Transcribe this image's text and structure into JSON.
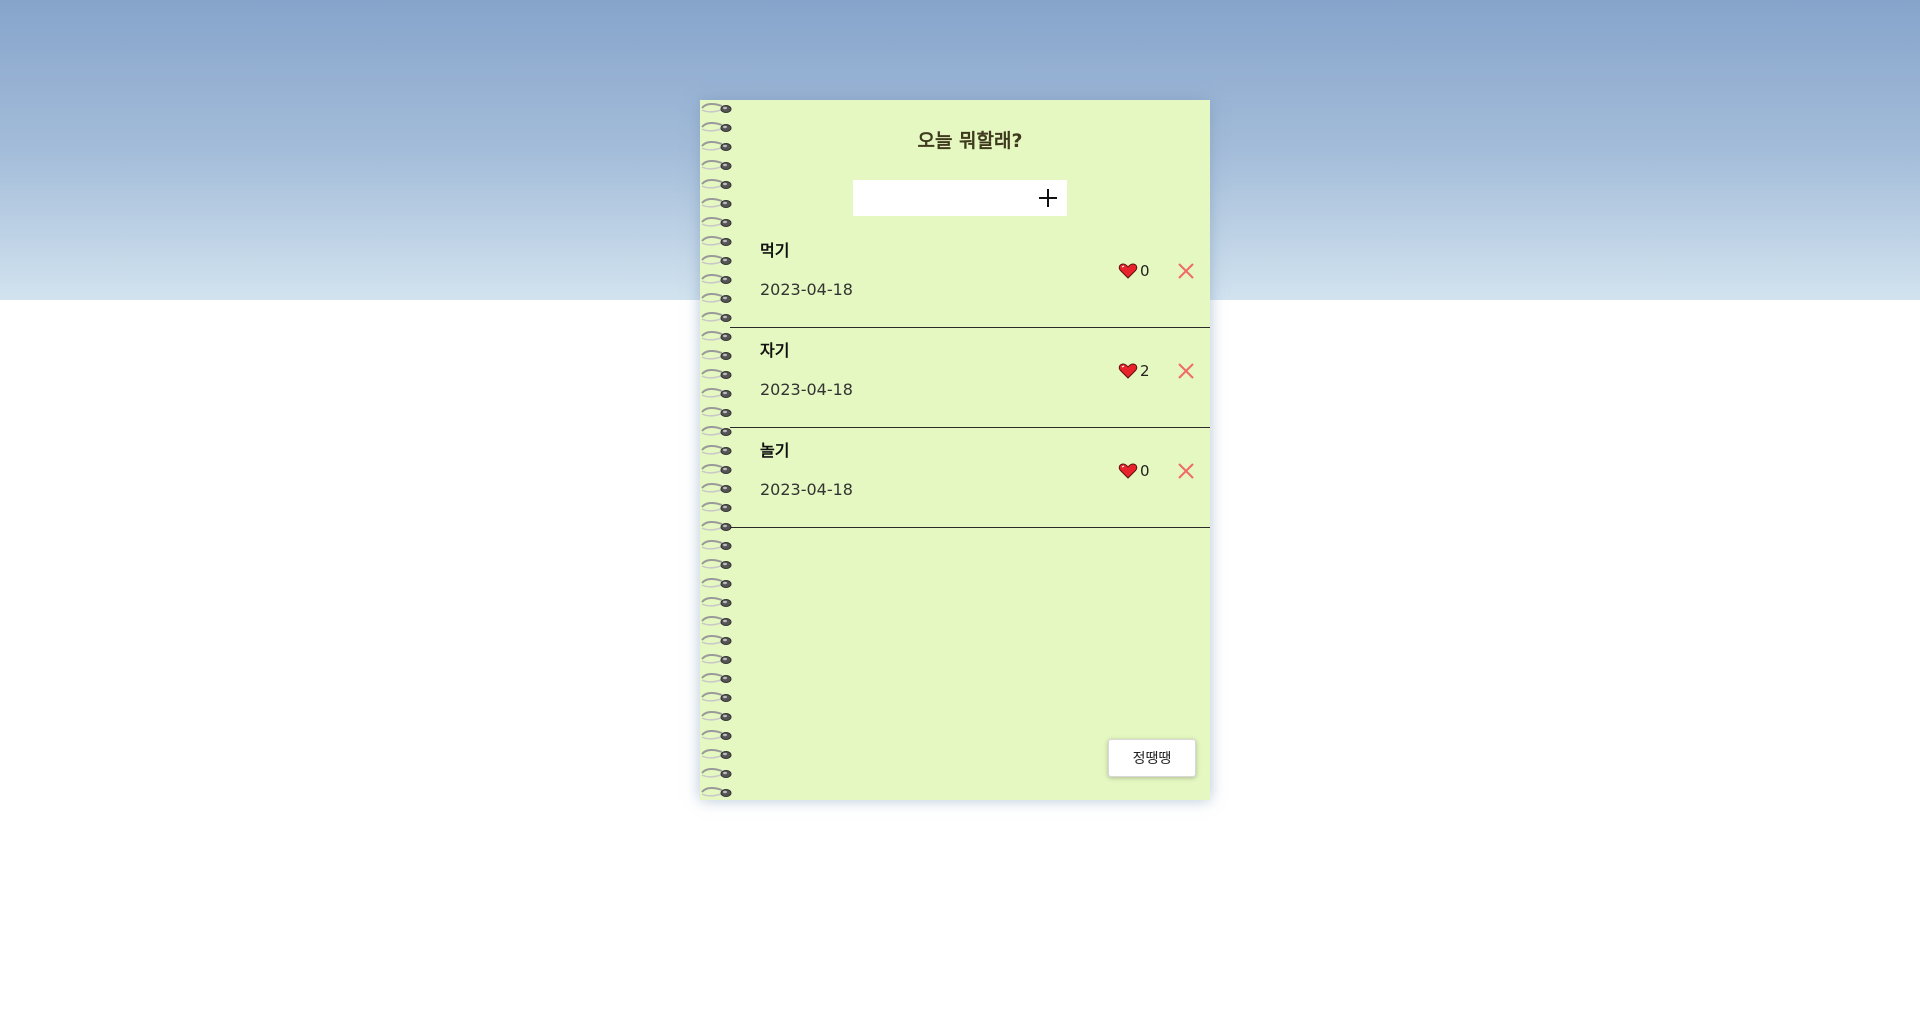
{
  "header": {
    "title": "오늘 뭐할래?"
  },
  "add_form": {
    "input_value": "",
    "input_placeholder": "",
    "add_icon": "plus-icon"
  },
  "todos": [
    {
      "title": "먹기",
      "date": "2023-04-18",
      "likes": "0"
    },
    {
      "title": "자기",
      "date": "2023-04-18",
      "likes": "2"
    },
    {
      "title": "놀기",
      "date": "2023-04-18",
      "likes": "0"
    }
  ],
  "icons": {
    "like": "heart-icon",
    "delete": "close-icon"
  },
  "colors": {
    "page_background": "#e5f8c1",
    "sky_top": "#86a4cb",
    "sky_bottom": "#d2e3ef",
    "heart": "#e8232b",
    "delete": "#f06a6a"
  },
  "footer": {
    "button_label": "정땡땡"
  }
}
